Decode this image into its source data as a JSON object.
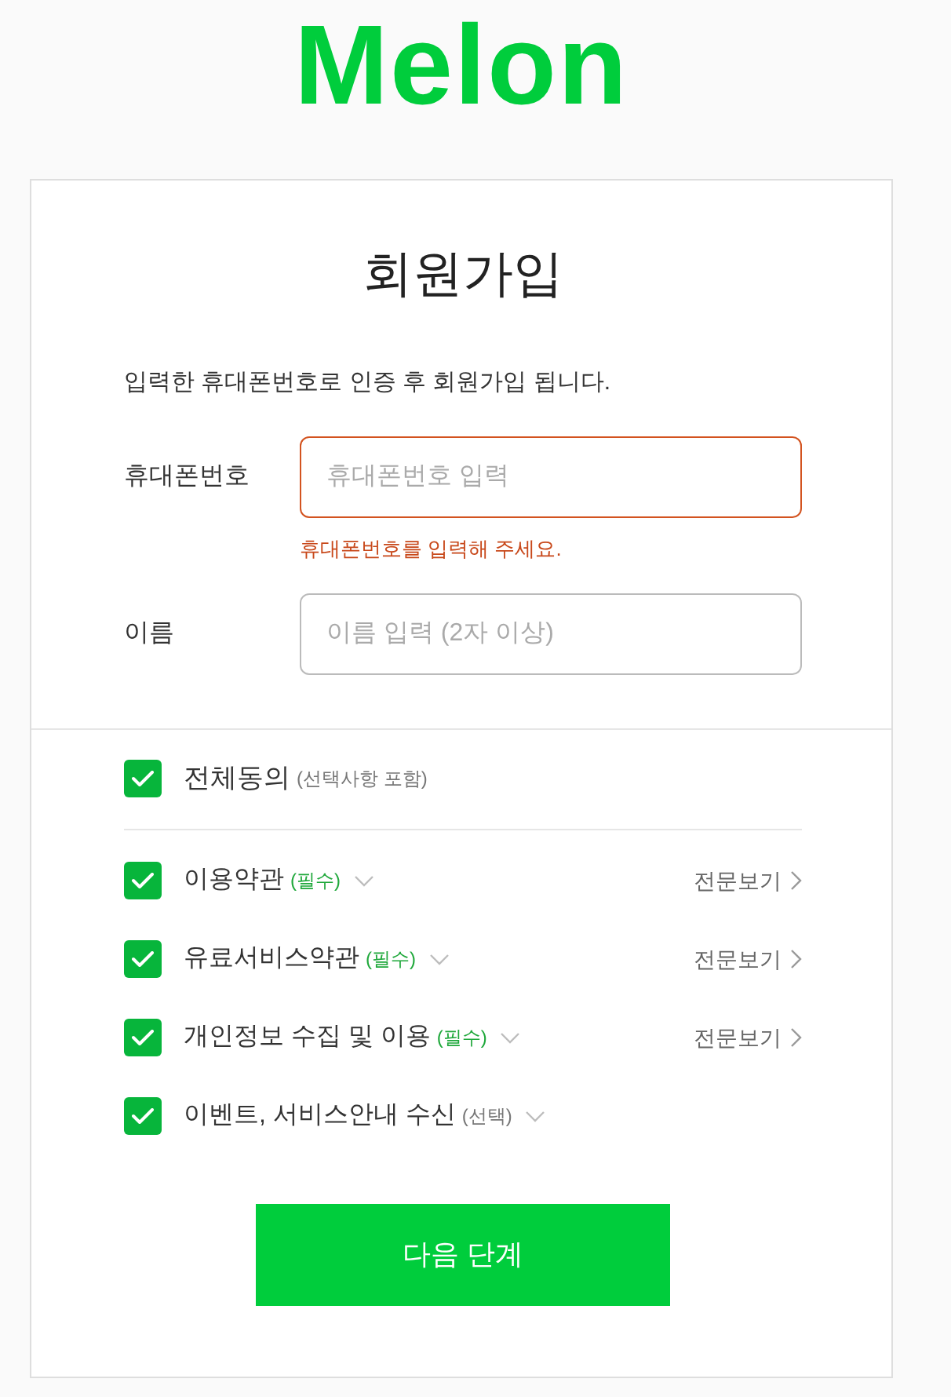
{
  "logo": {
    "text": "Melon"
  },
  "form": {
    "title": "회원가입",
    "description": "입력한 휴대폰번호로 인증 후 회원가입 됩니다.",
    "fields": [
      {
        "label": "휴대폰번호",
        "placeholder": "휴대폰번호 입력",
        "invalid": true,
        "error": "휴대폰번호를 입력해 주세요."
      },
      {
        "label": "이름",
        "placeholder": "이름 입력 (2자 이상)",
        "invalid": false
      }
    ]
  },
  "agree_all": {
    "label": "전체동의",
    "note": "(선택사항 포함)",
    "checked": true
  },
  "terms": [
    {
      "label": "이용약관",
      "tag": "(필수)",
      "required": true,
      "checked": true,
      "link": "전문보기"
    },
    {
      "label": "유료서비스약관",
      "tag": "(필수)",
      "required": true,
      "checked": true,
      "link": "전문보기"
    },
    {
      "label": "개인정보 수집 및 이용",
      "tag": "(필수)",
      "required": true,
      "checked": true,
      "link": "전문보기"
    },
    {
      "label": "이벤트, 서비스안내 수신",
      "tag": "(선택)",
      "required": false,
      "checked": true
    }
  ],
  "submit": {
    "label": "다음 단계"
  }
}
